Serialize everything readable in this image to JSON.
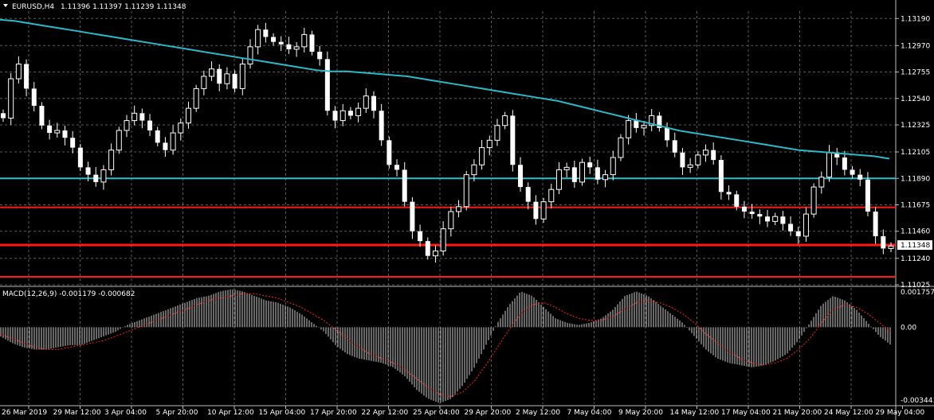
{
  "header": {
    "symbol": "EURUSD,H4",
    "ohlc": "1.11396 1.11397 1.11239 1.11348"
  },
  "macd_header": "MACD(12,26,9) -0.001179 -0.000682",
  "price_axis": {
    "labels": [
      "1.13190",
      "1.12970",
      "1.12755",
      "1.12540",
      "1.12325",
      "1.12105",
      "1.11890",
      "1.11675",
      "1.11460",
      "1.11240",
      "1.11025"
    ],
    "current_price": "1.11348"
  },
  "macd_axis": {
    "labels": [
      "0.001757",
      "0.00",
      "-0.003441"
    ]
  },
  "time_axis": {
    "labels": [
      "26 Mar 2019",
      "29 Mar 12:00",
      "3 Apr 04:00",
      "5 Apr 20:00",
      "10 Apr 12:00",
      "15 Apr 04:00",
      "17 Apr 20:00",
      "22 Apr 12:00",
      "25 Apr 04:00",
      "29 Apr 20:00",
      "2 May 12:00",
      "7 May 04:00",
      "9 May 20:00",
      "14 May 12:00",
      "17 May 04:00",
      "21 May 20:00",
      "24 May 12:00",
      "29 May 04:00"
    ]
  },
  "colors": {
    "background": "#000000",
    "grid": "#5a5a5a",
    "candle": "#ffffff",
    "ma": "#2bb9c9",
    "support_cyan": "#1fc3d0",
    "resistance_red": "#ff1a1a",
    "macd_hist": "#cfcfcf",
    "macd_signal": "#ff2020"
  },
  "chart_data": {
    "type": "line",
    "series": [
      {
        "values": [
          1.1238,
          1.127,
          1.1282,
          1.1262,
          1.1248,
          1.1232,
          1.1226,
          1.1228,
          1.1222,
          1.1214,
          1.1198,
          1.1192,
          1.1186,
          1.1196,
          1.1212,
          1.1228,
          1.1236,
          1.1242,
          1.1236,
          1.1228,
          1.1218,
          1.1212,
          1.1226,
          1.1234,
          1.1246,
          1.1262,
          1.1272,
          1.1278,
          1.1266,
          1.1274,
          1.1262,
          1.1282,
          1.1296,
          1.131,
          1.1304,
          1.13,
          1.1298,
          1.1294,
          1.1296,
          1.1306,
          1.1292,
          1.1286,
          1.1244,
          1.1236,
          1.1244,
          1.124,
          1.1246,
          1.1256,
          1.1244,
          1.122,
          1.12,
          1.1196,
          1.117,
          1.1146,
          1.1138,
          1.1126,
          1.113,
          1.1148,
          1.1162,
          1.1166,
          1.1192,
          1.12,
          1.1214,
          1.122,
          1.1232,
          1.124,
          1.12,
          1.1182,
          1.117,
          1.1156,
          1.117,
          1.118,
          1.1196,
          1.1198,
          1.1186,
          1.1202,
          1.1198,
          1.1188,
          1.1192,
          1.1206,
          1.1222,
          1.1236,
          1.123,
          1.1232,
          1.124,
          1.123,
          1.122,
          1.121,
          1.1198,
          1.12,
          1.1208,
          1.1212,
          1.1204,
          1.1178,
          1.1176,
          1.1166,
          1.1162,
          1.116,
          1.1158,
          1.1154,
          1.1158,
          1.1152,
          1.1146,
          1.1142,
          1.116,
          1.1182,
          1.119,
          1.121,
          1.1206,
          1.1196,
          1.1192,
          1.1188,
          1.1162,
          1.1142,
          1.1132,
          1.1134
        ]
      },
      {
        "values": [
          1.1318,
          1.1317,
          1.1315,
          1.1313,
          1.1311,
          1.1309,
          1.1307,
          1.1305,
          1.1303,
          1.1301,
          1.1299,
          1.1297,
          1.1295,
          1.1293,
          1.1291,
          1.1289,
          1.1287,
          1.1285,
          1.1283,
          1.1281,
          1.1279,
          1.1277,
          1.1276,
          1.1276,
          1.1275,
          1.1274,
          1.1273,
          1.1272,
          1.127,
          1.1268,
          1.1266,
          1.1264,
          1.1262,
          1.126,
          1.1258,
          1.1256,
          1.1254,
          1.1252,
          1.1249,
          1.1246,
          1.1243,
          1.124,
          1.1237,
          1.1234,
          1.1231,
          1.1228,
          1.1226,
          1.1224,
          1.1222,
          1.122,
          1.1218,
          1.1216,
          1.1214,
          1.1212,
          1.1211,
          1.121,
          1.1209,
          1.1208,
          1.1207,
          1.1205
        ]
      }
    ],
    "horizontal_lines": [
      1.1189,
      1.11655,
      1.11348,
      1.1109
    ],
    "y_range": [
      1.11025,
      1.1325
    ],
    "macd": {
      "histogram": [
        -0.0004,
        -0.0007,
        -0.0009,
        -0.001,
        -0.001,
        -0.0009,
        -0.0008,
        -0.0008,
        -0.0006,
        -0.0004,
        -0.0002,
        0.0001,
        0.0003,
        0.0005,
        0.0007,
        0.0009,
        0.0011,
        0.0013,
        0.0014,
        0.0016,
        0.0017,
        0.0016,
        0.0014,
        0.0012,
        0.0011,
        0.0009,
        0.0006,
        0.0002,
        -0.0002,
        -0.0008,
        -0.0012,
        -0.0014,
        -0.0015,
        -0.0016,
        -0.0018,
        -0.0022,
        -0.0028,
        -0.0032,
        -0.0034,
        -0.0032,
        -0.0026,
        -0.0018,
        -0.0008,
        0.0002,
        0.001,
        0.0016,
        0.0014,
        0.0009,
        0.0004,
        0.0002,
        0.0001,
        0.0002,
        0.0004,
        0.0008,
        0.0014,
        0.0016,
        0.0014,
        0.001,
        0.0006,
        0.0002,
        -0.0004,
        -0.001,
        -0.0014,
        -0.0016,
        -0.0017,
        -0.0018,
        -0.0017,
        -0.0015,
        -0.0012,
        -0.0006,
        0.0002,
        0.001,
        0.0014,
        0.0012,
        0.0008,
        0.0002,
        -0.0004,
        -0.0008
      ],
      "signal": [
        -0.0003,
        -0.0005,
        -0.0007,
        -0.0009,
        -0.001,
        -0.001,
        -0.0009,
        -0.0008,
        -0.0007,
        -0.0006,
        -0.0004,
        -0.0002,
        0.0,
        0.0002,
        0.0004,
        0.0006,
        0.0008,
        0.001,
        0.0012,
        0.0013,
        0.0014,
        0.0015,
        0.0015,
        0.0014,
        0.0013,
        0.0011,
        0.0009,
        0.0006,
        0.0003,
        -0.0001,
        -0.0005,
        -0.0009,
        -0.0012,
        -0.0014,
        -0.0016,
        -0.0019,
        -0.0023,
        -0.0027,
        -0.003,
        -0.0031,
        -0.0029,
        -0.0024,
        -0.0017,
        -0.0009,
        -0.0001,
        0.0006,
        0.001,
        0.0011,
        0.0009,
        0.0006,
        0.0004,
        0.0003,
        0.0003,
        0.0005,
        0.0008,
        0.0011,
        0.0012,
        0.0011,
        0.0009,
        0.0006,
        0.0002,
        -0.0003,
        -0.0007,
        -0.0011,
        -0.0014,
        -0.0016,
        -0.0017,
        -0.0016,
        -0.0014,
        -0.001,
        -0.0005,
        0.0002,
        0.0008,
        0.001,
        0.0009,
        0.0006,
        0.0002,
        -0.0002
      ],
      "y_range": [
        -0.003441,
        0.001757
      ]
    }
  }
}
